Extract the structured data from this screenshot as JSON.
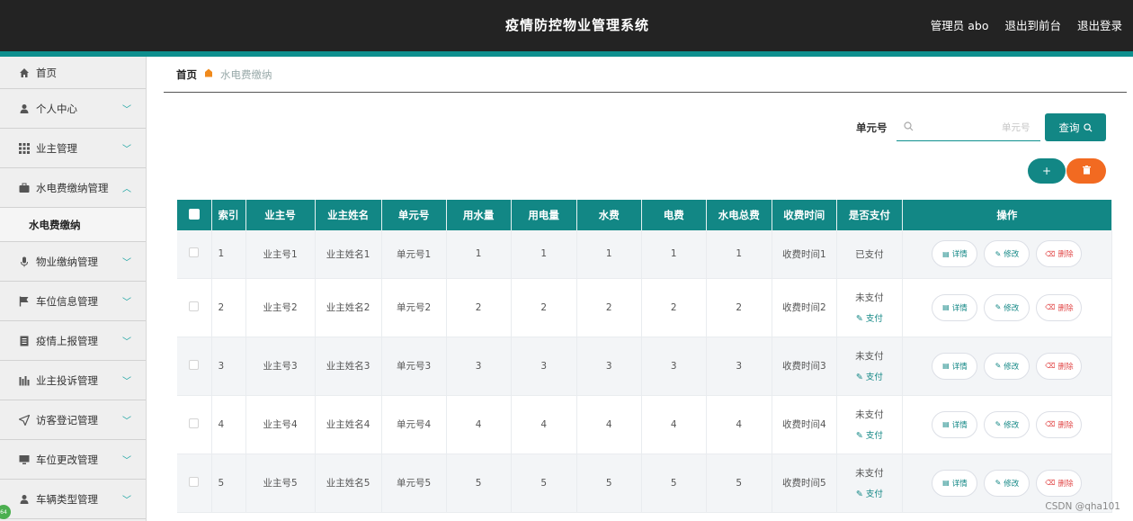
{
  "header": {
    "title": "疫情防控物业管理系统",
    "admin_label": "管理员 abo",
    "back_front": "退出到前台",
    "logout": "退出登录"
  },
  "sidebar": {
    "items": [
      {
        "label": "首页",
        "icon": "home-icon"
      },
      {
        "label": "个人中心",
        "icon": "user-icon"
      },
      {
        "label": "业主管理",
        "icon": "grid-icon"
      },
      {
        "label": "水电费缴纳管理",
        "icon": "briefcase-icon",
        "expanded": true
      },
      {
        "label": "物业缴纳管理",
        "icon": "mic-icon"
      },
      {
        "label": "车位信息管理",
        "icon": "flag-icon"
      },
      {
        "label": "疫情上报管理",
        "icon": "doc-icon"
      },
      {
        "label": "业主投诉管理",
        "icon": "bars-icon"
      },
      {
        "label": "访客登记管理",
        "icon": "send-icon"
      },
      {
        "label": "车位更改管理",
        "icon": "monitor-icon"
      },
      {
        "label": "车辆类型管理",
        "icon": "user-icon"
      }
    ],
    "sub_item": "水电费缴纳"
  },
  "breadcrumb": {
    "home": "首页",
    "current": "水电费缴纳"
  },
  "search": {
    "label": "单元号",
    "placeholder": "单元号",
    "value": "",
    "button": "查询"
  },
  "toolbar": {
    "add": "+",
    "delete_batch": "🗑"
  },
  "table": {
    "headers": [
      "索引",
      "业主号",
      "业主姓名",
      "单元号",
      "用水量",
      "用电量",
      "水费",
      "电费",
      "水电总费",
      "收费时间",
      "是否支付",
      "操作"
    ],
    "rows": [
      {
        "idx": "1",
        "owner_no": "业主号1",
        "owner_name": "业主姓名1",
        "unit": "单元号1",
        "water": "1",
        "power": "1",
        "water_fee": "1",
        "power_fee": "1",
        "total": "1",
        "time": "收费时间1",
        "paid": "已支付",
        "pay_link": ""
      },
      {
        "idx": "2",
        "owner_no": "业主号2",
        "owner_name": "业主姓名2",
        "unit": "单元号2",
        "water": "2",
        "power": "2",
        "water_fee": "2",
        "power_fee": "2",
        "total": "2",
        "time": "收费时间2",
        "paid": "未支付",
        "pay_link": "支付"
      },
      {
        "idx": "3",
        "owner_no": "业主号3",
        "owner_name": "业主姓名3",
        "unit": "单元号3",
        "water": "3",
        "power": "3",
        "water_fee": "3",
        "power_fee": "3",
        "total": "3",
        "time": "收费时间3",
        "paid": "未支付",
        "pay_link": "支付"
      },
      {
        "idx": "4",
        "owner_no": "业主号4",
        "owner_name": "业主姓名4",
        "unit": "单元号4",
        "water": "4",
        "power": "4",
        "water_fee": "4",
        "power_fee": "4",
        "total": "4",
        "time": "收费时间4",
        "paid": "未支付",
        "pay_link": "支付"
      },
      {
        "idx": "5",
        "owner_no": "业主号5",
        "owner_name": "业主姓名5",
        "unit": "单元号5",
        "water": "5",
        "power": "5",
        "water_fee": "5",
        "power_fee": "5",
        "total": "5",
        "time": "收费时间5",
        "paid": "未支付",
        "pay_link": "支付"
      }
    ],
    "actions": {
      "detail": "详情",
      "edit": "修改",
      "delete": "删除"
    }
  },
  "watermark": "CSDN @qha101",
  "colors": {
    "accent": "#128785",
    "danger": "#f26a21",
    "topbar": "#232323"
  }
}
